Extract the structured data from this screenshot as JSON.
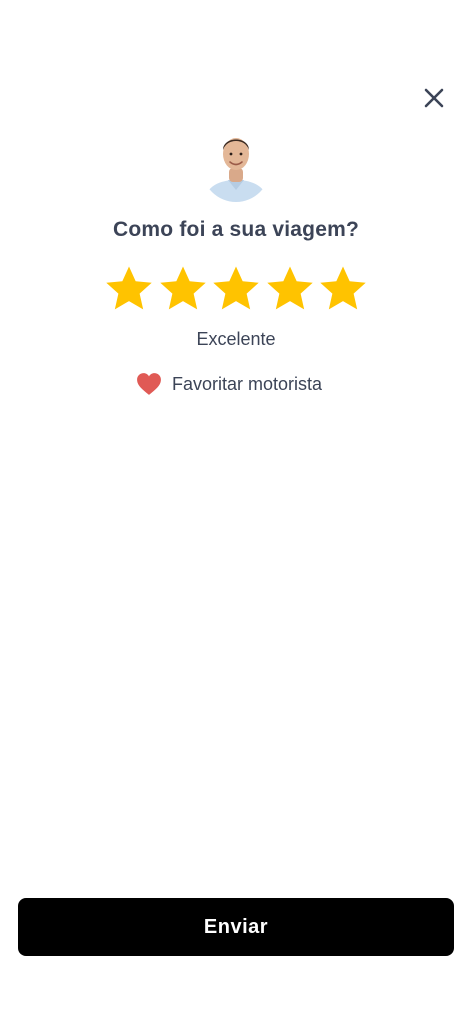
{
  "header": {
    "close_icon": "close-icon"
  },
  "driver": {
    "avatar_icon": "driver-avatar"
  },
  "rating": {
    "question": "Como foi a sua viagem?",
    "stars_selected": 5,
    "stars_total": 5,
    "star_color": "#FFC300",
    "label": "Excelente"
  },
  "favorite": {
    "label": "Favoritar motorista",
    "heart_color": "#E05A55"
  },
  "footer": {
    "submit_label": "Enviar"
  },
  "colors": {
    "text": "#3C4457",
    "button_bg": "#000000",
    "button_text": "#FFFFFF"
  }
}
